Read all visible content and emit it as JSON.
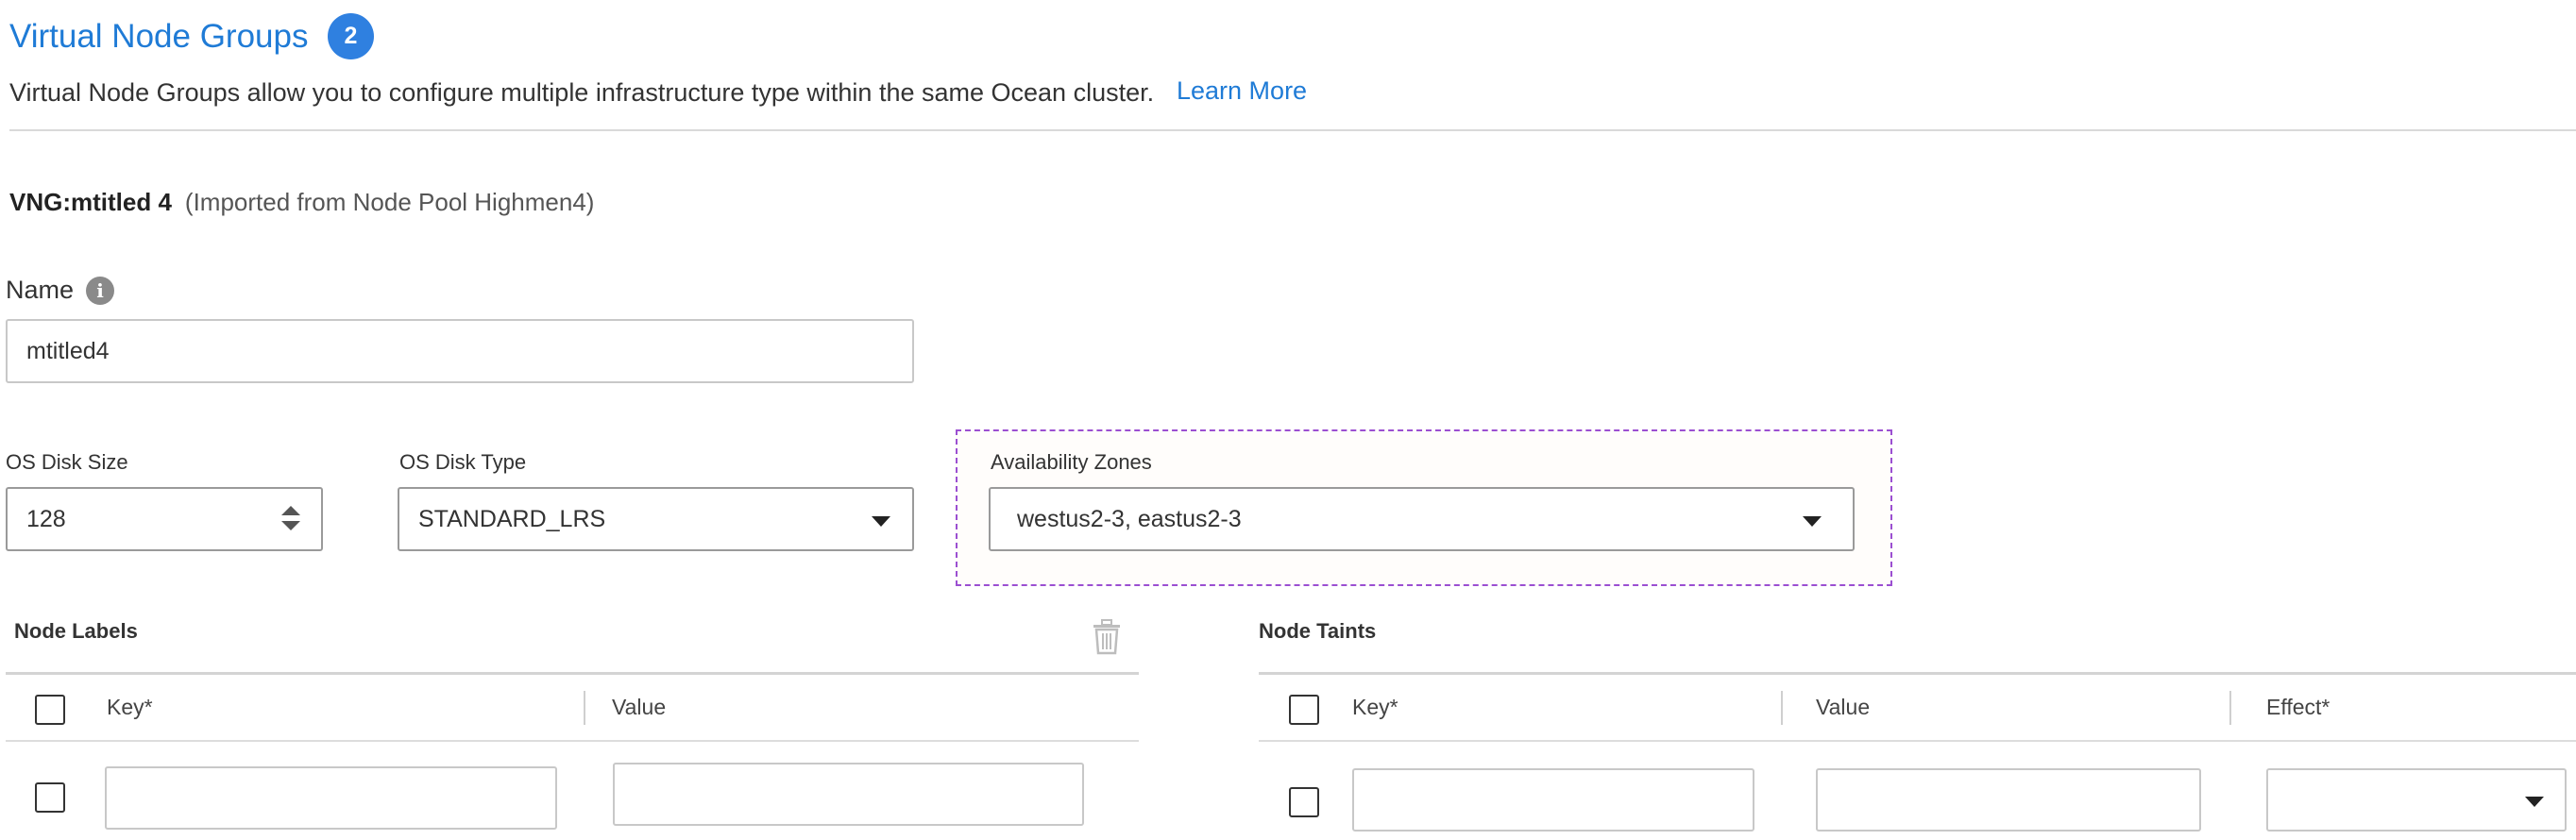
{
  "header": {
    "title": "Virtual Node Groups",
    "count_badge": "2",
    "description": "Virtual Node Groups allow you to configure multiple infrastructure type within the same Ocean cluster.",
    "learn_more": "Learn More"
  },
  "vng": {
    "title": "VNG:mtitled 4",
    "subtitle": "(Imported from Node Pool Highmen4)"
  },
  "name_field": {
    "label": "Name",
    "value": "mtitled4",
    "info_icon": "info-icon"
  },
  "os_disk_size": {
    "label": "OS Disk Size",
    "value": "128"
  },
  "os_disk_type": {
    "label": "OS Disk Type",
    "value": "STANDARD_LRS"
  },
  "availability_zones": {
    "label": "Availability Zones",
    "value": "westus2-3,  eastus2-3"
  },
  "node_labels": {
    "title": "Node Labels",
    "columns": [
      "Key*",
      "Value"
    ],
    "rows": [
      {
        "key": "",
        "value": ""
      }
    ]
  },
  "node_taints": {
    "title": "Node Taints",
    "columns": [
      "Key*",
      "Value",
      "Effect*"
    ],
    "rows": [
      {
        "key": "",
        "value": "",
        "effect": ""
      }
    ]
  },
  "colors": {
    "accent": "#1f7bd6",
    "badge": "#2f80e0",
    "focus_outline": "#9b4fd1"
  }
}
